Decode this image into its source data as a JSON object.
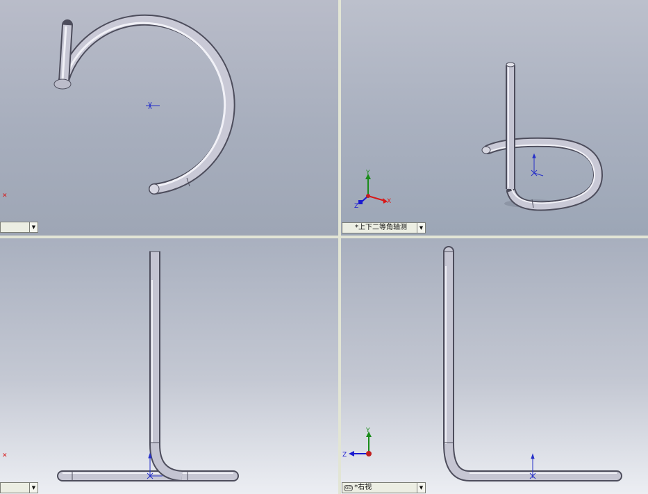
{
  "viewports": {
    "top_left": {
      "label": ""
    },
    "top_right": {
      "label": "*上下二等角轴测"
    },
    "bottom_left": {
      "label": ""
    },
    "bottom_right": {
      "label": "*右视"
    }
  },
  "triad": {
    "x": "X",
    "y": "Y",
    "z": "Z"
  },
  "colors": {
    "axis_x": "#d81818",
    "axis_y": "#1a8c1a",
    "axis_z": "#1a1ad0",
    "tube": "#c4c4d2",
    "splitter": "#e2e5d5"
  }
}
